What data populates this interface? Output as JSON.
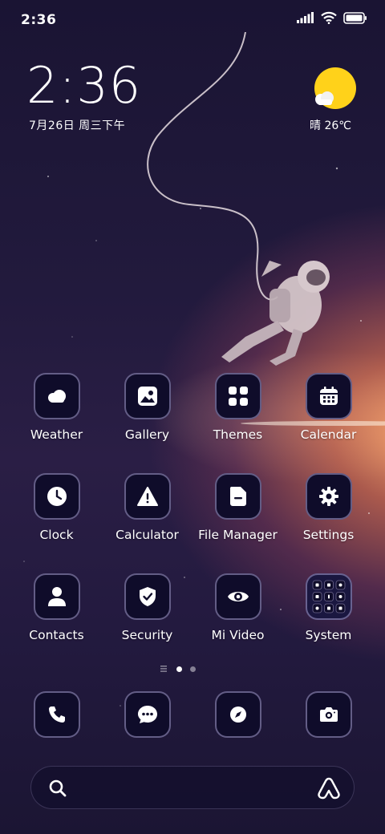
{
  "status_bar": {
    "time": "2:36"
  },
  "lock_widget": {
    "time": "2:36",
    "date": "7月26日 周三下午"
  },
  "weather_widget": {
    "condition": "晴",
    "temperature": "26℃",
    "text": "晴 26℃",
    "sun_color": "#ffd21a"
  },
  "apps": [
    {
      "label": "Weather",
      "icon": "weather-icon"
    },
    {
      "label": "Gallery",
      "icon": "gallery-icon"
    },
    {
      "label": "Themes",
      "icon": "themes-icon"
    },
    {
      "label": "Calendar",
      "icon": "calendar-icon"
    },
    {
      "label": "Clock",
      "icon": "clock-icon"
    },
    {
      "label": "Calculator",
      "icon": "calculator-icon"
    },
    {
      "label": "File Manager",
      "icon": "file-manager-icon"
    },
    {
      "label": "Settings",
      "icon": "gear-icon"
    },
    {
      "label": "Contacts",
      "icon": "contacts-icon"
    },
    {
      "label": "Security",
      "icon": "shield-icon"
    },
    {
      "label": "Mi Video",
      "icon": "eye-icon"
    },
    {
      "label": "System",
      "icon": "folder-icon"
    }
  ],
  "dock": [
    {
      "icon": "phone-icon"
    },
    {
      "icon": "messages-icon"
    },
    {
      "icon": "browser-icon"
    },
    {
      "icon": "camera-icon"
    }
  ],
  "page_indicator": {
    "current": 1,
    "total": 2
  },
  "search_bar": {
    "left_icon": "search-icon",
    "right_icon": "assistant-icon"
  },
  "colors": {
    "icon_bg": "#0f0c2a",
    "icon_border": "#aaa0d2",
    "sun": "#ffd21a"
  }
}
